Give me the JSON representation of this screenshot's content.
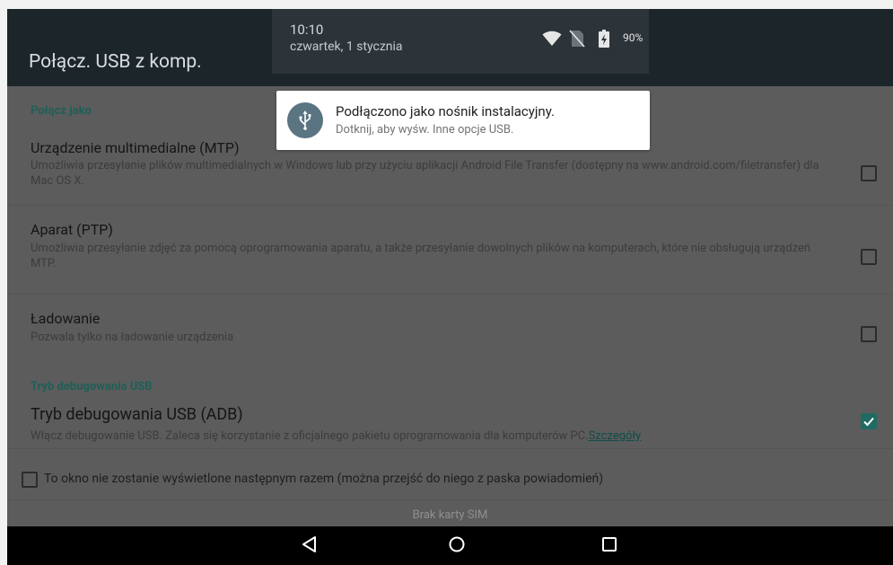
{
  "app": {
    "title": "Połącz. USB z komp."
  },
  "status": {
    "time": "10:10",
    "date": "czwartek, 1 stycznia",
    "battery": "90%",
    "icons": [
      "wifi-icon",
      "no-sim-icon",
      "battery-charging-icon"
    ]
  },
  "notification": {
    "icon": "usb-icon",
    "title": "Podłączono jako nośnik instalacyjny.",
    "subtitle": "Dotknij, aby wyśw. Inne opcje USB."
  },
  "sections": {
    "connect_as": "Połącz jako",
    "debug": "Tryb debugowania USB"
  },
  "options": {
    "mtp": {
      "title": "Urządzenie multimedialne (MTP)",
      "desc": "Umożliwia przesyłanie plików multimedialnych w Windows lub przy użyciu aplikacji Android File Transfer (dostępny na www.android.com/filetransfer) dla Mac OS X.",
      "checked": false
    },
    "ptp": {
      "title": "Aparat (PTP)",
      "desc": "Umożliwia przesyłanie zdjęć za pomocą oprogramowania aparatu, a także przesyłanie dowolnych plików na komputerach, które nie obsługują urządzeń MTP.",
      "checked": false
    },
    "charging": {
      "title": "Ładowanie",
      "desc": "Pozwala tylko na ładowanie urządzenia",
      "checked": false
    },
    "adb": {
      "title": "Tryb debugowania USB (ADB)",
      "desc": "Włącz debugowanie USB. Zaleca się korzystanie z oficjalnego pakietu oprogramowania dla komputerów PC.",
      "link": "Szczegóły",
      "checked": true
    }
  },
  "footer": {
    "dont_show_label": "To okno nie zostanie wyświetlone następnym razem (można przejść do niego z paska powiadomień)",
    "dont_show_checked": false,
    "sim": "Brak karty SIM"
  },
  "navigation": {
    "buttons": [
      "back-icon",
      "home-icon",
      "recents-icon"
    ]
  },
  "colors": {
    "accent": "#1f6b62",
    "appbar": "#1c252a",
    "dim_background": "#5c5c5c"
  }
}
